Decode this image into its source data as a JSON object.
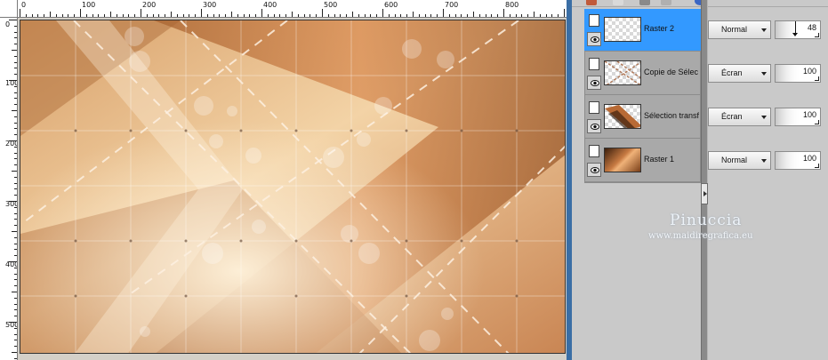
{
  "rulers": {
    "horizontal": [
      "0",
      "100",
      "200",
      "300",
      "400",
      "500",
      "600",
      "700",
      "800"
    ],
    "vertical": [
      "0",
      "100",
      "200",
      "300",
      "400",
      "500"
    ]
  },
  "layers": [
    {
      "name": "Raster 2",
      "blend": "Normal",
      "opacity": "48",
      "selected": true,
      "thumb": "transparent"
    },
    {
      "name": "Copie de Sélec",
      "blend": "Écran",
      "opacity": "100",
      "selected": false,
      "thumb": "pattern"
    },
    {
      "name": "Sélection transf",
      "blend": "Écran",
      "opacity": "100",
      "selected": false,
      "thumb": "diagonal"
    },
    {
      "name": "Raster 1",
      "blend": "Normal",
      "opacity": "100",
      "selected": false,
      "thumb": "copper"
    }
  ],
  "watermark": {
    "title": "Pinuccia",
    "url": "www.maidiregrafica.eu"
  },
  "colors": {
    "selection": "#3399ff",
    "panel": "#c9c9c9",
    "copper": "#c27a45",
    "cream": "#f6dcb5"
  }
}
